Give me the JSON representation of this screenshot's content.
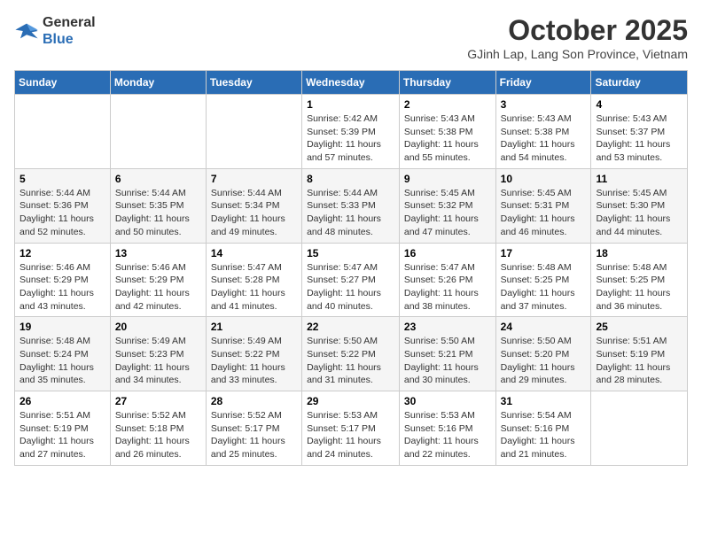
{
  "logo": {
    "line1": "General",
    "line2": "Blue"
  },
  "title": "October 2025",
  "subtitle": "GJinh Lap, Lang Son Province, Vietnam",
  "weekdays": [
    "Sunday",
    "Monday",
    "Tuesday",
    "Wednesday",
    "Thursday",
    "Friday",
    "Saturday"
  ],
  "weeks": [
    [
      {
        "day": "",
        "info": ""
      },
      {
        "day": "",
        "info": ""
      },
      {
        "day": "",
        "info": ""
      },
      {
        "day": "1",
        "info": "Sunrise: 5:42 AM\nSunset: 5:39 PM\nDaylight: 11 hours and 57 minutes."
      },
      {
        "day": "2",
        "info": "Sunrise: 5:43 AM\nSunset: 5:38 PM\nDaylight: 11 hours and 55 minutes."
      },
      {
        "day": "3",
        "info": "Sunrise: 5:43 AM\nSunset: 5:38 PM\nDaylight: 11 hours and 54 minutes."
      },
      {
        "day": "4",
        "info": "Sunrise: 5:43 AM\nSunset: 5:37 PM\nDaylight: 11 hours and 53 minutes."
      }
    ],
    [
      {
        "day": "5",
        "info": "Sunrise: 5:44 AM\nSunset: 5:36 PM\nDaylight: 11 hours and 52 minutes."
      },
      {
        "day": "6",
        "info": "Sunrise: 5:44 AM\nSunset: 5:35 PM\nDaylight: 11 hours and 50 minutes."
      },
      {
        "day": "7",
        "info": "Sunrise: 5:44 AM\nSunset: 5:34 PM\nDaylight: 11 hours and 49 minutes."
      },
      {
        "day": "8",
        "info": "Sunrise: 5:44 AM\nSunset: 5:33 PM\nDaylight: 11 hours and 48 minutes."
      },
      {
        "day": "9",
        "info": "Sunrise: 5:45 AM\nSunset: 5:32 PM\nDaylight: 11 hours and 47 minutes."
      },
      {
        "day": "10",
        "info": "Sunrise: 5:45 AM\nSunset: 5:31 PM\nDaylight: 11 hours and 46 minutes."
      },
      {
        "day": "11",
        "info": "Sunrise: 5:45 AM\nSunset: 5:30 PM\nDaylight: 11 hours and 44 minutes."
      }
    ],
    [
      {
        "day": "12",
        "info": "Sunrise: 5:46 AM\nSunset: 5:29 PM\nDaylight: 11 hours and 43 minutes."
      },
      {
        "day": "13",
        "info": "Sunrise: 5:46 AM\nSunset: 5:29 PM\nDaylight: 11 hours and 42 minutes."
      },
      {
        "day": "14",
        "info": "Sunrise: 5:47 AM\nSunset: 5:28 PM\nDaylight: 11 hours and 41 minutes."
      },
      {
        "day": "15",
        "info": "Sunrise: 5:47 AM\nSunset: 5:27 PM\nDaylight: 11 hours and 40 minutes."
      },
      {
        "day": "16",
        "info": "Sunrise: 5:47 AM\nSunset: 5:26 PM\nDaylight: 11 hours and 38 minutes."
      },
      {
        "day": "17",
        "info": "Sunrise: 5:48 AM\nSunset: 5:25 PM\nDaylight: 11 hours and 37 minutes."
      },
      {
        "day": "18",
        "info": "Sunrise: 5:48 AM\nSunset: 5:25 PM\nDaylight: 11 hours and 36 minutes."
      }
    ],
    [
      {
        "day": "19",
        "info": "Sunrise: 5:48 AM\nSunset: 5:24 PM\nDaylight: 11 hours and 35 minutes."
      },
      {
        "day": "20",
        "info": "Sunrise: 5:49 AM\nSunset: 5:23 PM\nDaylight: 11 hours and 34 minutes."
      },
      {
        "day": "21",
        "info": "Sunrise: 5:49 AM\nSunset: 5:22 PM\nDaylight: 11 hours and 33 minutes."
      },
      {
        "day": "22",
        "info": "Sunrise: 5:50 AM\nSunset: 5:22 PM\nDaylight: 11 hours and 31 minutes."
      },
      {
        "day": "23",
        "info": "Sunrise: 5:50 AM\nSunset: 5:21 PM\nDaylight: 11 hours and 30 minutes."
      },
      {
        "day": "24",
        "info": "Sunrise: 5:50 AM\nSunset: 5:20 PM\nDaylight: 11 hours and 29 minutes."
      },
      {
        "day": "25",
        "info": "Sunrise: 5:51 AM\nSunset: 5:19 PM\nDaylight: 11 hours and 28 minutes."
      }
    ],
    [
      {
        "day": "26",
        "info": "Sunrise: 5:51 AM\nSunset: 5:19 PM\nDaylight: 11 hours and 27 minutes."
      },
      {
        "day": "27",
        "info": "Sunrise: 5:52 AM\nSunset: 5:18 PM\nDaylight: 11 hours and 26 minutes."
      },
      {
        "day": "28",
        "info": "Sunrise: 5:52 AM\nSunset: 5:17 PM\nDaylight: 11 hours and 25 minutes."
      },
      {
        "day": "29",
        "info": "Sunrise: 5:53 AM\nSunset: 5:17 PM\nDaylight: 11 hours and 24 minutes."
      },
      {
        "day": "30",
        "info": "Sunrise: 5:53 AM\nSunset: 5:16 PM\nDaylight: 11 hours and 22 minutes."
      },
      {
        "day": "31",
        "info": "Sunrise: 5:54 AM\nSunset: 5:16 PM\nDaylight: 11 hours and 21 minutes."
      },
      {
        "day": "",
        "info": ""
      }
    ]
  ]
}
